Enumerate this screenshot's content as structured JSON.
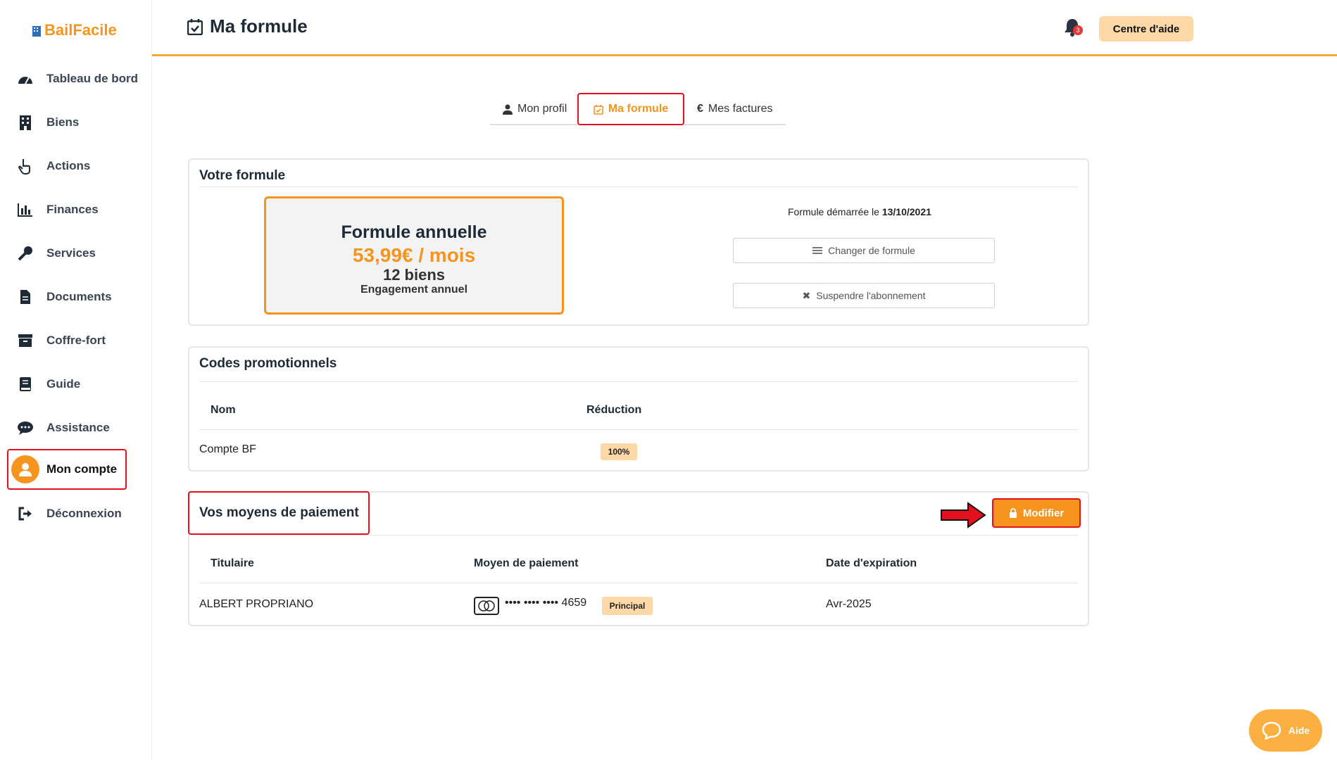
{
  "app": {
    "name": "BailFacile"
  },
  "sidebar": {
    "items": [
      {
        "label": "Tableau de bord",
        "icon": "gauge-icon"
      },
      {
        "label": "Biens",
        "icon": "building-icon"
      },
      {
        "label": "Actions",
        "icon": "hand-pointer-icon"
      },
      {
        "label": "Finances",
        "icon": "bar-chart-icon"
      },
      {
        "label": "Services",
        "icon": "key-icon"
      },
      {
        "label": "Documents",
        "icon": "file-icon"
      },
      {
        "label": "Coffre-fort",
        "icon": "archive-icon"
      },
      {
        "label": "Guide",
        "icon": "book-icon"
      },
      {
        "label": "Assistance",
        "icon": "chat-icon"
      },
      {
        "label": "Mon compte",
        "icon": "user-avatar-icon",
        "active": true
      },
      {
        "label": "Déconnexion",
        "icon": "logout-icon"
      }
    ]
  },
  "header": {
    "title": "Ma formule",
    "help_label": "Centre d'aide",
    "notifications_count": "3"
  },
  "tabs": [
    {
      "label": "Mon profil",
      "icon": "user-icon"
    },
    {
      "label": "Ma formule",
      "icon": "calendar-check-icon",
      "active": true
    },
    {
      "label": "Mes factures",
      "icon": "euro-icon"
    }
  ],
  "formule": {
    "section_title": "Votre formule",
    "plan_name": "Formule annuelle",
    "price": "53,99€ / mois",
    "count": "12 biens",
    "engagement": "Engagement annuel",
    "started_prefix": "Formule démarrée le",
    "started_date": "13/10/2021",
    "change_label": "Changer de formule",
    "suspend_label": "Suspendre l'abonnement"
  },
  "promo": {
    "section_title": "Codes promotionnels",
    "headers": [
      "Nom",
      "Réduction"
    ],
    "rows": [
      {
        "name": "Compte BF",
        "reduction": "100%"
      }
    ]
  },
  "payment": {
    "section_title": "Vos moyens de paiement",
    "modify_label": "Modifier",
    "headers": [
      "Titulaire",
      "Moyen de paiement",
      "Date d'expiration"
    ],
    "rows": [
      {
        "holder": "ALBERT PROPRIANO",
        "card_number": "•••• •••• •••• 4659",
        "badge": "Principal",
        "expiry": "Avr-2025"
      }
    ]
  },
  "help_widget": {
    "label": "Aide"
  },
  "colors": {
    "accent": "#f7941d",
    "highlight": "#e3101e",
    "soft_accent": "#fcd9a7"
  }
}
